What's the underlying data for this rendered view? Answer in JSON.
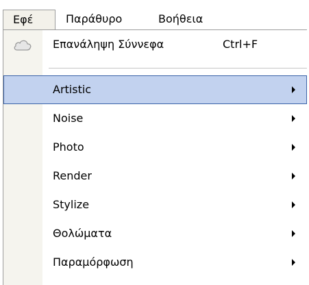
{
  "menubar": {
    "items": [
      {
        "label": "Εφέ"
      },
      {
        "label": "Παράθυρο"
      },
      {
        "label": "Βοήθεια"
      }
    ]
  },
  "dropdown": {
    "repeat_item": {
      "icon": "cloud-icon",
      "label": "Επανάληψη Σύννεφα",
      "shortcut": "Ctrl+F"
    },
    "items": [
      {
        "label": "Artistic"
      },
      {
        "label": "Noise"
      },
      {
        "label": "Photo"
      },
      {
        "label": "Render"
      },
      {
        "label": "Stylize"
      },
      {
        "label": "Θολώματα"
      },
      {
        "label": "Παραμόρφωση"
      }
    ]
  },
  "colors": {
    "highlight_fill": "#c2d2ef",
    "highlight_border": "#3a63a8",
    "icon_column": "#f5f4ee"
  }
}
